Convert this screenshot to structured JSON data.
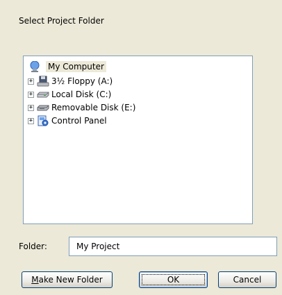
{
  "dialog": {
    "instructions": "Select Project Folder"
  },
  "tree": {
    "root": {
      "label": "My Computer",
      "icon": "my-computer-icon"
    },
    "items": [
      {
        "label": "3½ Floppy (A:)",
        "icon": "floppy-drive-icon",
        "expander": "+"
      },
      {
        "label": "Local Disk (C:)",
        "icon": "hard-disk-icon",
        "expander": "+"
      },
      {
        "label": "Removable Disk (E:)",
        "icon": "removable-disk-icon",
        "expander": "+"
      },
      {
        "label": "Control Panel",
        "icon": "control-panel-icon",
        "expander": "+"
      }
    ]
  },
  "folder": {
    "label": "Folder:",
    "value": "My Project"
  },
  "buttons": {
    "make_new_folder_mnemonic": "M",
    "make_new_folder_rest": "ake New Folder",
    "ok": "OK",
    "cancel": "Cancel"
  },
  "colors": {
    "dialog_background": "#ece9d8",
    "border_blue": "#7f9db9",
    "button_border": "#003c74"
  }
}
